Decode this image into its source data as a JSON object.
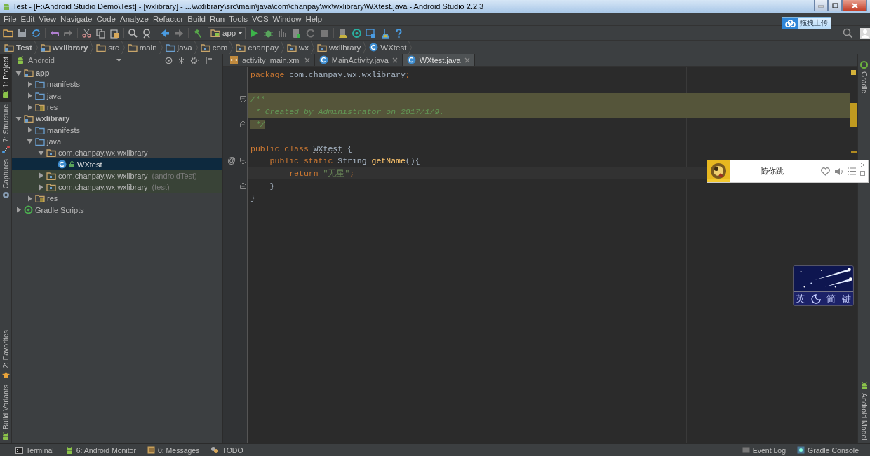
{
  "window": {
    "title": "Test - [F:\\Android Studio Demo\\Test] - [wxlibrary] - ...\\wxlibrary\\src\\main\\java\\com\\chanpay\\wx\\wxlibrary\\WXtest.java - Android Studio 2.2.3"
  },
  "menu": [
    "File",
    "Edit",
    "View",
    "Navigate",
    "Code",
    "Analyze",
    "Refactor",
    "Build",
    "Run",
    "Tools",
    "VCS",
    "Window",
    "Help"
  ],
  "toolbar": {
    "run_config": "app"
  },
  "upload_button": {
    "label": "拖拽上传"
  },
  "breadcrumbs": [
    {
      "label": "Test",
      "kind": "module"
    },
    {
      "label": "wxlibrary",
      "kind": "module"
    },
    {
      "label": "src",
      "kind": "folder"
    },
    {
      "label": "main",
      "kind": "folder"
    },
    {
      "label": "java",
      "kind": "source"
    },
    {
      "label": "com",
      "kind": "package"
    },
    {
      "label": "chanpay",
      "kind": "package"
    },
    {
      "label": "wx",
      "kind": "package"
    },
    {
      "label": "wxlibrary",
      "kind": "package"
    },
    {
      "label": "WXtest",
      "kind": "class"
    }
  ],
  "left_tool_windows": {
    "top": [
      {
        "label": "1: Project",
        "selected": true
      },
      {
        "label": "7: Structure",
        "selected": false
      },
      {
        "label": "Captures",
        "selected": false
      }
    ],
    "bottom": [
      {
        "label": "2: Favorites",
        "selected": false
      },
      {
        "label": "Build Variants",
        "selected": false
      }
    ]
  },
  "right_tool_windows": {
    "top": [
      {
        "label": "Gradle"
      }
    ],
    "bottom": [
      {
        "label": "Android Model"
      }
    ]
  },
  "project": {
    "view": "Android",
    "tree": [
      {
        "label": "app",
        "kind": "module",
        "expanded": true,
        "selected": false,
        "children": [
          {
            "label": "manifests",
            "kind": "source",
            "expanded": false,
            "selected": false
          },
          {
            "label": "java",
            "kind": "source",
            "expanded": false,
            "selected": false
          },
          {
            "label": "res",
            "kind": "res",
            "expanded": false,
            "selected": false
          }
        ]
      },
      {
        "label": "wxlibrary",
        "kind": "module",
        "expanded": true,
        "selected": false,
        "children": [
          {
            "label": "manifests",
            "kind": "source",
            "expanded": false,
            "selected": false
          },
          {
            "label": "java",
            "kind": "source",
            "expanded": true,
            "selected": false,
            "children": [
              {
                "label": "com.chanpay.wx.wxlibrary",
                "kind": "package",
                "expanded": true,
                "selected": false,
                "children": [
                  {
                    "label": "WXtest",
                    "kind": "class",
                    "selected": true
                  }
                ]
              },
              {
                "label": "com.chanpay.wx.wxlibrary",
                "suffix": "(androidTest)",
                "kind": "test-package",
                "expanded": false,
                "selected": false
              },
              {
                "label": "com.chanpay.wx.wxlibrary",
                "suffix": "(test)",
                "kind": "test-package",
                "expanded": false,
                "selected": false
              }
            ]
          },
          {
            "label": "res",
            "kind": "res",
            "expanded": false,
            "selected": false
          }
        ]
      },
      {
        "label": "Gradle Scripts",
        "kind": "gradle",
        "expanded": false,
        "selected": false
      }
    ]
  },
  "editor": {
    "tabs": [
      {
        "label": "activity_main.xml",
        "kind": "xml",
        "selected": false
      },
      {
        "label": "MainActivity.java",
        "kind": "class",
        "selected": false
      },
      {
        "label": "WXtest.java",
        "kind": "class",
        "selected": true
      }
    ],
    "lines": [
      {
        "kind": "code",
        "fold_start": false,
        "fold_end": false,
        "tokens": [
          {
            "kind": "keyword",
            "text": "package"
          },
          {
            "kind": "plain",
            "text": " com.chanpay.wx.wxlibrary"
          },
          {
            "kind": "keyword",
            "text": ";"
          }
        ]
      },
      {
        "kind": "blank",
        "fold_start": false,
        "fold_end": false
      },
      {
        "kind": "band",
        "fold_start": true,
        "fold_end": false,
        "tokens": [
          {
            "kind": "comment",
            "text": "/**"
          }
        ]
      },
      {
        "kind": "band",
        "fold_start": false,
        "fold_end": false,
        "tokens": [
          {
            "kind": "comment",
            "text": " * Created by Administrator on 2017/1/9."
          }
        ]
      },
      {
        "kind": "band-text",
        "fold_start": false,
        "fold_end": true,
        "tokens": [
          {
            "kind": "comment",
            "text": " */"
          }
        ]
      },
      {
        "kind": "blank",
        "fold_start": false,
        "fold_end": false
      },
      {
        "kind": "code",
        "fold_start": false,
        "fold_end": false,
        "tokens": [
          {
            "kind": "keyword",
            "text": "public class "
          },
          {
            "kind": "typo",
            "text": "WXtest"
          },
          {
            "kind": "plain",
            "text": " {"
          }
        ]
      },
      {
        "kind": "code",
        "fold_start": true,
        "fold_end": false,
        "marker": "@",
        "tokens": [
          {
            "kind": "keyword",
            "text": "    public static "
          },
          {
            "kind": "plain",
            "text": "String "
          },
          {
            "kind": "method",
            "text": "getName"
          },
          {
            "kind": "plain",
            "text": "(){"
          }
        ]
      },
      {
        "kind": "current",
        "fold_start": false,
        "fold_end": false,
        "tokens": [
          {
            "kind": "keyword",
            "text": "        return "
          },
          {
            "kind": "string",
            "text": "\"无星\""
          },
          {
            "kind": "keyword",
            "text": ";"
          }
        ]
      },
      {
        "kind": "code",
        "fold_start": false,
        "fold_end": true,
        "tokens": [
          {
            "kind": "plain",
            "text": "    }"
          }
        ]
      },
      {
        "kind": "code",
        "fold_start": false,
        "fold_end": false,
        "tokens": [
          {
            "kind": "plain",
            "text": "}"
          }
        ]
      }
    ]
  },
  "music_player": {
    "title": "随你跳"
  },
  "ime": {
    "labels": [
      "英",
      "简",
      "键"
    ]
  },
  "bottom_bar": {
    "left": [
      {
        "label": "Terminal",
        "kind": "terminal"
      },
      {
        "label": "6: Android Monitor",
        "kind": "android"
      },
      {
        "label": "0: Messages",
        "kind": "messages"
      },
      {
        "label": "TODO",
        "kind": "todo"
      }
    ],
    "right": [
      {
        "label": "Event Log",
        "kind": "log"
      },
      {
        "label": "Gradle Console",
        "kind": "console"
      }
    ]
  }
}
